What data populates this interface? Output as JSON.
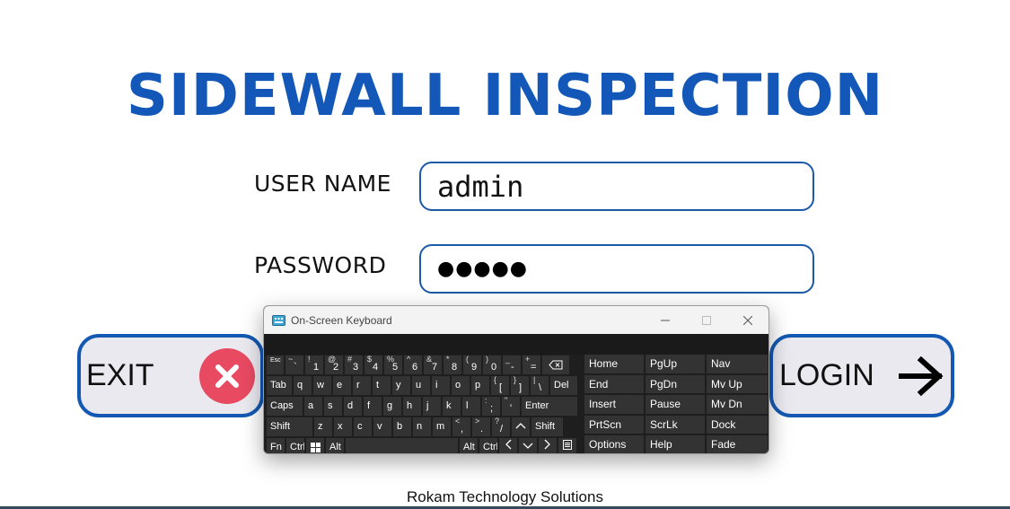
{
  "title": "SIDEWALL INSPECTION",
  "form": {
    "username_label": "USER NAME",
    "username_value": "admin",
    "password_label": "PASSWORD",
    "password_mask": "●●●●●"
  },
  "buttons": {
    "exit_label": "EXIT",
    "login_label": "LOGIN"
  },
  "footer": "Rokam Technology Solutions",
  "keyboard": {
    "window_title": "On-Screen Keyboard",
    "row1": [
      {
        "m": "Esc",
        "s": ""
      },
      {
        "m": "`",
        "s": "~"
      },
      {
        "m": "1",
        "s": "!"
      },
      {
        "m": "2",
        "s": "@"
      },
      {
        "m": "3",
        "s": "#"
      },
      {
        "m": "4",
        "s": "$"
      },
      {
        "m": "5",
        "s": "%"
      },
      {
        "m": "6",
        "s": "^"
      },
      {
        "m": "7",
        "s": "&"
      },
      {
        "m": "8",
        "s": "*"
      },
      {
        "m": "9",
        "s": "("
      },
      {
        "m": "0",
        "s": ")"
      },
      {
        "m": "-",
        "s": "_"
      },
      {
        "m": "=",
        "s": "+"
      }
    ],
    "row2": [
      "Tab",
      "q",
      "w",
      "e",
      "r",
      "t",
      "y",
      "u",
      "i",
      "o",
      "p",
      "[",
      "]",
      "\\",
      "Del"
    ],
    "row2_shift": {
      "[": "{",
      "]": "}",
      "\\": "|"
    },
    "row3": [
      "Caps",
      "a",
      "s",
      "d",
      "f",
      "g",
      "h",
      "j",
      "k",
      "l",
      ";",
      "'",
      "Enter"
    ],
    "row3_shift": {
      ";": ":",
      "'": "\""
    },
    "row4": [
      "Shift",
      "z",
      "x",
      "c",
      "v",
      "b",
      "n",
      "m",
      ",",
      ".",
      "/",
      "^",
      "Shift"
    ],
    "row4_shift": {
      ",": "<",
      ".": ">",
      "/": "?"
    },
    "row5": [
      "Fn",
      "Ctrl",
      "Alt",
      "Alt",
      "Ctrl"
    ],
    "nav_keys": [
      "Home",
      "PgUp",
      "Nav",
      "End",
      "PgDn",
      "Mv Up",
      "Insert",
      "Pause",
      "Mv Dn",
      "PrtScn",
      "ScrLk",
      "Dock",
      "Options",
      "Help",
      "Fade"
    ]
  },
  "colors": {
    "brand_blue": "#1358b8",
    "exit_red": "#e84a62",
    "keyboard_key": "#333333"
  }
}
